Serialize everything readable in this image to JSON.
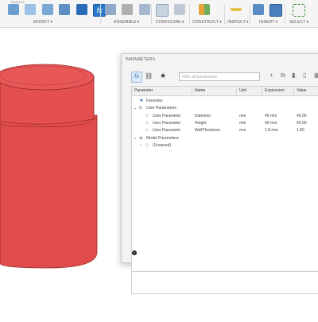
{
  "toolbar": {
    "top_strip": "MANAGE",
    "groups": [
      {
        "label": "MODIFY"
      },
      {
        "label": "ASSEMBLE"
      },
      {
        "label": "CONFIGURE"
      },
      {
        "label": "CONSTRUCT"
      },
      {
        "label": "INSPECT"
      },
      {
        "label": "INSERT"
      },
      {
        "label": "SELECT"
      }
    ]
  },
  "dialog": {
    "title": "PARAMETERS",
    "search_placeholder": "Filter all parameters",
    "columns": [
      "Parameter",
      "Name",
      "Unit",
      "Expression",
      "Value"
    ],
    "favorites_label": "Favorites",
    "user_params_label": "User Parameters",
    "user_params": [
      {
        "type": "User Parameter",
        "name": "Diameter",
        "unit": "mm",
        "expression": "40 mm",
        "value": "40.00"
      },
      {
        "type": "User Parameter",
        "name": "Height",
        "unit": "mm",
        "expression": "40 mm",
        "value": "40.00"
      },
      {
        "type": "User Parameter",
        "name": "WallThickness",
        "unit": "mm",
        "expression": "1.8 mm",
        "value": "1.80"
      }
    ],
    "model_params_label": "Model Parameters",
    "unsaved_label": "(Unsaved)"
  },
  "colors": {
    "body_red": "#e04b4b",
    "body_dark": "#9c2a2a",
    "accent_blue": "#2a6bb5"
  }
}
